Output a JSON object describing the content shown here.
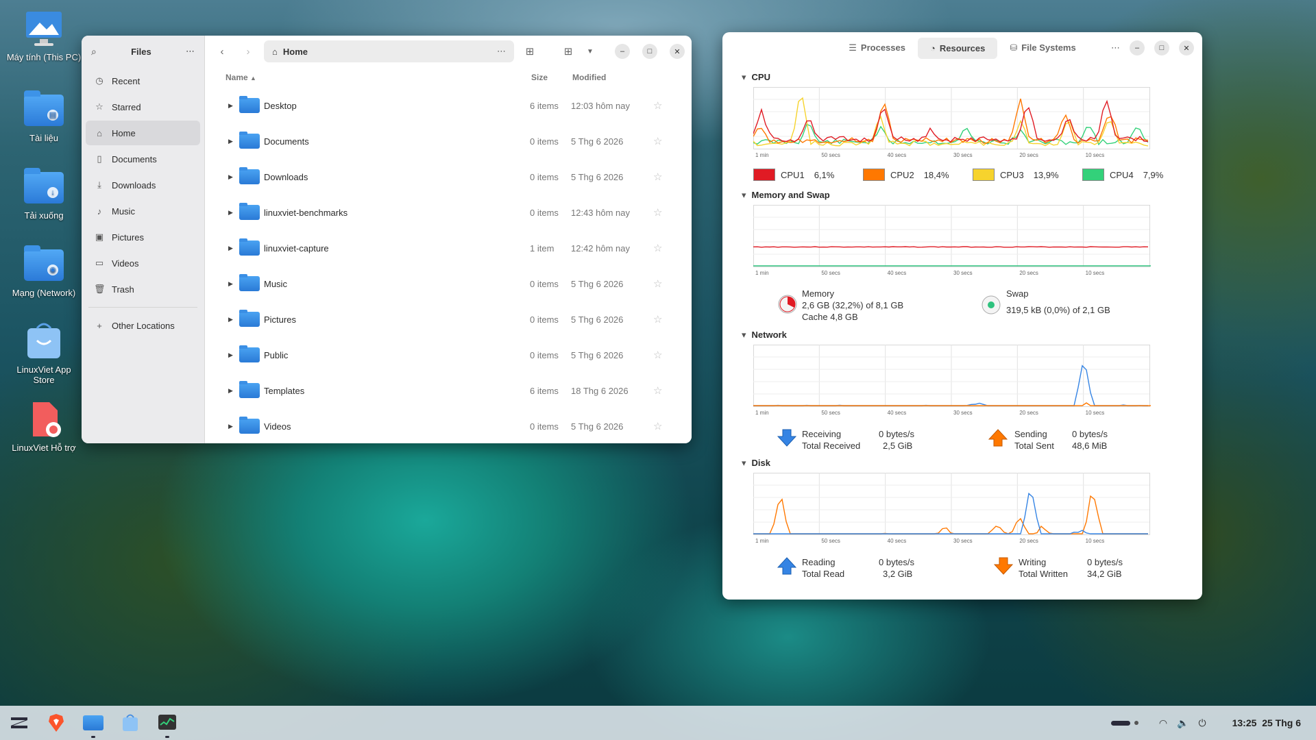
{
  "desktop": {
    "icons": [
      {
        "label": "Máy tính (This PC)",
        "icon": "computer-icon"
      },
      {
        "label": "Tài liệu",
        "icon": "documents-folder-icon"
      },
      {
        "label": "Tải xuống",
        "icon": "downloads-folder-icon"
      },
      {
        "label": "Mạng (Network)",
        "icon": "network-folder-icon"
      },
      {
        "label": "LinuxViet App Store",
        "icon": "app-store-icon"
      },
      {
        "label": "LinuxViet Hỗ trợ",
        "icon": "support-icon"
      }
    ]
  },
  "files": {
    "sidebar_title": "Files",
    "path": "Home",
    "sidebar": [
      {
        "label": "Recent",
        "icon": "clock-icon"
      },
      {
        "label": "Starred",
        "icon": "star-icon"
      },
      {
        "label": "Home",
        "icon": "home-icon",
        "active": true
      },
      {
        "label": "Documents",
        "icon": "document-icon"
      },
      {
        "label": "Downloads",
        "icon": "download-icon"
      },
      {
        "label": "Music",
        "icon": "music-icon"
      },
      {
        "label": "Pictures",
        "icon": "picture-icon"
      },
      {
        "label": "Videos",
        "icon": "video-icon"
      },
      {
        "label": "Trash",
        "icon": "trash-icon"
      },
      {
        "label": "Other Locations",
        "icon": "plus-icon"
      }
    ],
    "columns": {
      "name": "Name",
      "size": "Size",
      "modified": "Modified"
    },
    "rows": [
      {
        "name": "Desktop",
        "size": "6 items",
        "modified": "12:03 hôm nay"
      },
      {
        "name": "Documents",
        "size": "0 items",
        "modified": "5 Thg 6 2026"
      },
      {
        "name": "Downloads",
        "size": "0 items",
        "modified": "5 Thg 6 2026"
      },
      {
        "name": "linuxviet-benchmarks",
        "size": "0 items",
        "modified": "12:43 hôm nay"
      },
      {
        "name": "linuxviet-capture",
        "size": "1 item",
        "modified": "12:42 hôm nay"
      },
      {
        "name": "Music",
        "size": "0 items",
        "modified": "5 Thg 6 2026"
      },
      {
        "name": "Pictures",
        "size": "0 items",
        "modified": "5 Thg 6 2026"
      },
      {
        "name": "Public",
        "size": "0 items",
        "modified": "5 Thg 6 2026"
      },
      {
        "name": "Templates",
        "size": "6 items",
        "modified": "18 Thg 6 2026"
      },
      {
        "name": "Videos",
        "size": "0 items",
        "modified": "5 Thg 6 2026"
      }
    ]
  },
  "sysmon": {
    "tabs": [
      "Processes",
      "Resources",
      "File Systems"
    ],
    "active_tab": "Resources",
    "time_labels": [
      "1 min",
      "50 secs",
      "40 secs",
      "30 secs",
      "20 secs",
      "10 secs"
    ],
    "cpu": {
      "title": "CPU",
      "y_labels": [
        "100 %",
        "80 %",
        "60 %",
        "40 %",
        "20 %"
      ],
      "legend": [
        {
          "name": "CPU1",
          "value": "6,1%",
          "color": "#e01b24"
        },
        {
          "name": "CPU2",
          "value": "18,4%",
          "color": "#ff7800"
        },
        {
          "name": "CPU3",
          "value": "13,9%",
          "color": "#f6d32d"
        },
        {
          "name": "CPU4",
          "value": "7,9%",
          "color": "#33d17a"
        }
      ]
    },
    "memory": {
      "title": "Memory and Swap",
      "y_labels": [
        "100 %",
        "80 %",
        "60 %",
        "40 %",
        "20 %"
      ],
      "mem_label": "Memory",
      "mem_value": "2,6 GB (32,2%) of 8,1 GB",
      "cache": "Cache 4,8 GB",
      "swap_label": "Swap",
      "swap_value": "319,5 kB (0,0%) of 2,1 GB"
    },
    "network": {
      "title": "Network",
      "y_labels": [
        "60,0 KiB/s",
        "48,0 KiB/s",
        "36,0 KiB/s",
        "24,0 KiB/s",
        "12,0 KiB/s"
      ],
      "receiving_label": "Receiving",
      "receiving_value": "0 bytes/s",
      "total_received_label": "Total Received",
      "total_received_value": "2,5 GiB",
      "sending_label": "Sending",
      "sending_value": "0 bytes/s",
      "total_sent_label": "Total Sent",
      "total_sent_value": "48,6 MiB"
    },
    "disk": {
      "title": "Disk",
      "y_labels": [
        "6,0 MiB/s",
        "4,8 MiB/s",
        "3,6 MiB/s",
        "2,4 MiB/s",
        "1,2 MiB/s"
      ],
      "reading_label": "Reading",
      "reading_value": "0 bytes/s",
      "total_read_label": "Total Read",
      "total_read_value": "3,2 GiB",
      "writing_label": "Writing",
      "writing_value": "0 bytes/s",
      "total_written_label": "Total Written",
      "total_written_value": "34,2 GiB"
    }
  },
  "taskbar": {
    "clock": "13:25",
    "date": "25 Thg 6",
    "apps": [
      "zorin-menu-icon",
      "brave-browser-icon",
      "files-icon",
      "software-store-icon",
      "system-monitor-icon"
    ]
  }
}
